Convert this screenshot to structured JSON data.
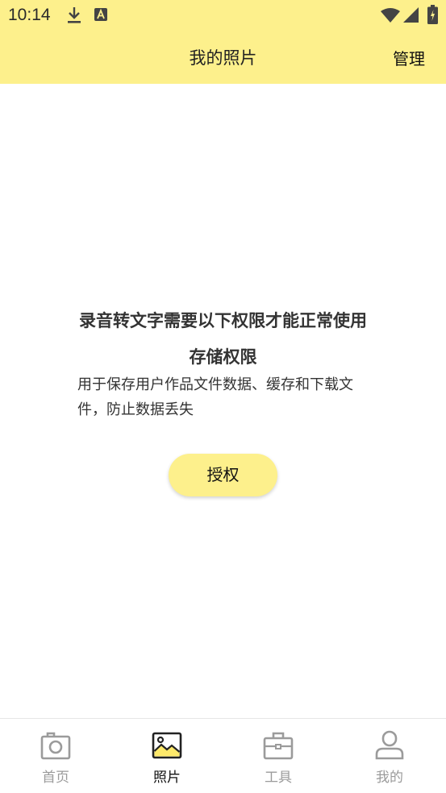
{
  "status_bar": {
    "time": "10:14",
    "icons": [
      "download-icon",
      "a-notification-icon",
      "wifi-icon",
      "signal-icon",
      "battery-icon"
    ]
  },
  "header": {
    "title": "我的照片",
    "manage_label": "管理"
  },
  "permission": {
    "title": "录音转文字需要以下权限才能正常使用",
    "name": "存储权限",
    "description": "用于保存用户作品文件数据、缓存和下载文件，防止数据丢失",
    "button_label": "授权"
  },
  "tabs": [
    {
      "label": "首页",
      "icon": "camera-icon",
      "active": false
    },
    {
      "label": "照片",
      "icon": "photo-icon",
      "active": true
    },
    {
      "label": "工具",
      "icon": "toolbox-icon",
      "active": false
    },
    {
      "label": "我的",
      "icon": "user-icon",
      "active": false
    }
  ],
  "colors": {
    "accent": "#fdf08c",
    "active_tab_text": "#111111",
    "inactive_tab_text": "#9b9b9b"
  }
}
